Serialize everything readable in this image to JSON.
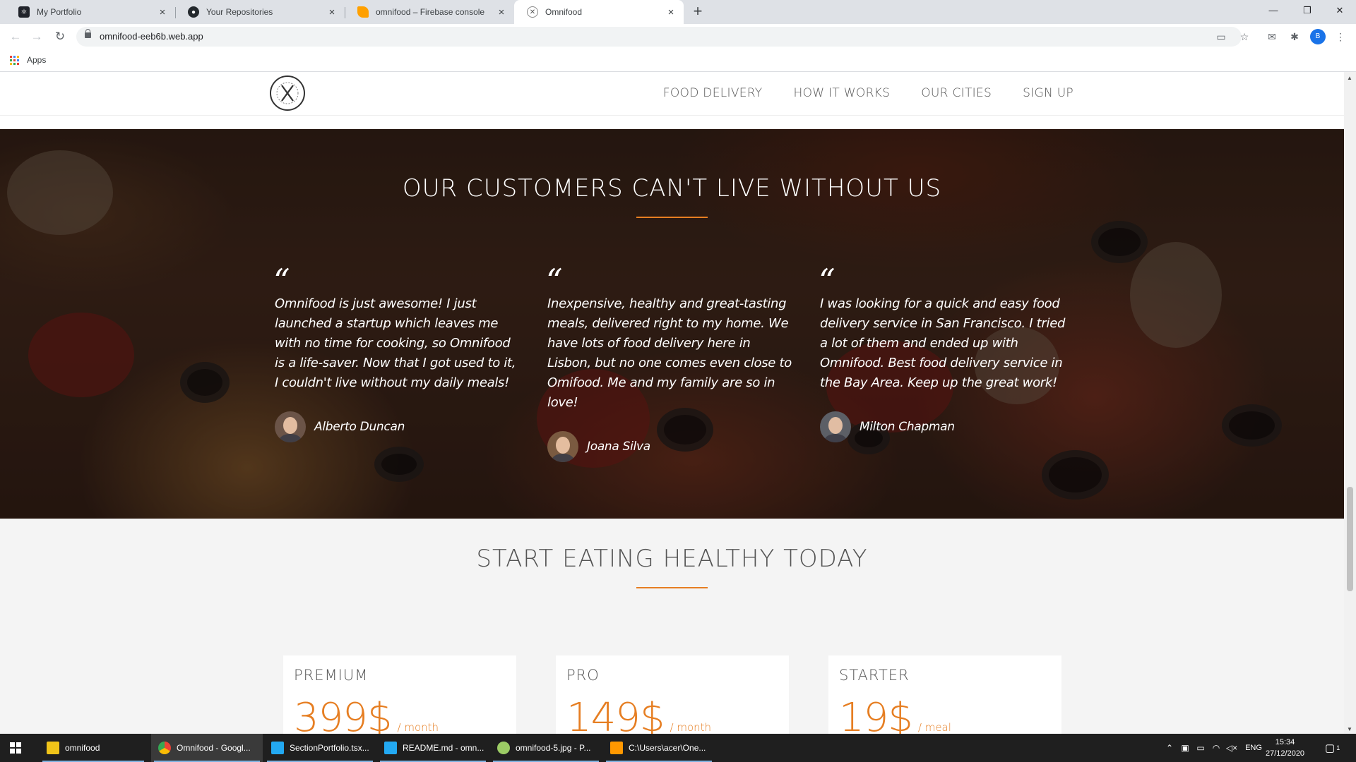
{
  "browser": {
    "tabs": [
      {
        "title": "My Portfolio",
        "icon": "react-icon",
        "color": "#20232a",
        "active": false
      },
      {
        "title": "Your Repositories",
        "icon": "github-icon",
        "color": "#24292e",
        "active": false
      },
      {
        "title": "omnifood – Firebase console",
        "icon": "firebase-icon",
        "color": "#ffa000",
        "active": false
      },
      {
        "title": "Omnifood",
        "icon": "omnifood-favicon-icon",
        "color": "#888888",
        "active": true
      }
    ],
    "url": "omnifood-eeb6b.web.app",
    "bookmarks_apps_label": "Apps"
  },
  "site": {
    "nav": [
      "FOOD DELIVERY",
      "HOW IT WORKS",
      "OUR CITIES",
      "SIGN UP"
    ],
    "testimonials": {
      "title": "OUR CUSTOMERS CAN'T LIVE WITHOUT US",
      "quote_mark": "“",
      "items": [
        {
          "text": "Omnifood is just awesome! I just launched a startup which leaves me with no time for cooking, so Omnifood is a life-saver. Now that I got used to it, I couldn't live without my daily meals!",
          "author": "Alberto Duncan"
        },
        {
          "text": "Inexpensive, healthy and great-tasting meals, delivered right to my home. We have lots of food delivery here in Lisbon, but no one comes even close to Omifood. Me and my family are so in love!",
          "author": "Joana Silva"
        },
        {
          "text": "I was looking for a quick and easy food delivery service in San Francisco. I tried a lot of them and ended up with Omnifood. Best food delivery service in the Bay Area. Keep up the great work!",
          "author": "Milton Chapman"
        }
      ]
    },
    "pricing": {
      "title": "START EATING HEALTHY TODAY",
      "plans": [
        {
          "name": "PREMIUM",
          "price": "399$",
          "unit": "/ month"
        },
        {
          "name": "PRO",
          "price": "149$",
          "unit": "/ month"
        },
        {
          "name": "STARTER",
          "price": "19$",
          "unit": "/ meal"
        }
      ]
    },
    "accent_color": "#e67e22"
  },
  "taskbar": {
    "items": [
      {
        "label": "omnifood",
        "icon": "folder-icon",
        "color": "#f0c419",
        "active": false
      },
      {
        "label": "Omnifood - Googl...",
        "icon": "chrome-icon",
        "color": "#4285f4",
        "active": true
      },
      {
        "label": "SectionPortfolio.tsx...",
        "icon": "vscode-icon",
        "color": "#23a9f2",
        "active": false
      },
      {
        "label": "README.md - omn...",
        "icon": "vscode-icon",
        "color": "#23a9f2",
        "active": false
      },
      {
        "label": "omnifood-5.jpg - P...",
        "icon": "paint-icon",
        "color": "#9ccc65",
        "active": false
      },
      {
        "label": "C:\\Users\\acer\\One...",
        "icon": "sublime-icon",
        "color": "#ff9800",
        "active": false
      }
    ],
    "language": "ENG",
    "time": "15:34",
    "date": "27/12/2020",
    "notification_count": "1"
  }
}
